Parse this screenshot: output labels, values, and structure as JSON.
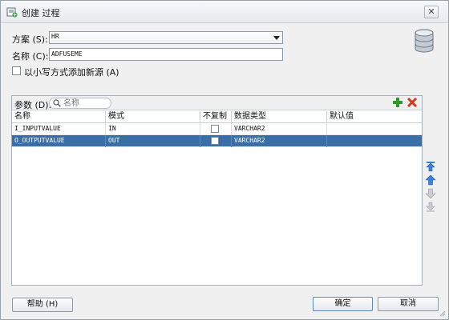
{
  "window": {
    "title": "创建 过程"
  },
  "form": {
    "schema_label": "方案 (S):",
    "schema_value": "HR",
    "name_label": "名称 (C):",
    "name_value": "ADFUSEME",
    "lowercase_label": "以小写方式添加新源 (A)"
  },
  "params": {
    "label": "参数 (D):",
    "search_placeholder": "名称",
    "columns": [
      "名称",
      "模式",
      "不复制",
      "数据类型",
      "默认值"
    ],
    "rows": [
      {
        "name": "I_INPUTVALUE",
        "mode": "IN",
        "nocopy": false,
        "type": "VARCHAR2",
        "default": "",
        "selected": false
      },
      {
        "name": "O_OUTPUTVALUE",
        "mode": "OUT",
        "nocopy": false,
        "type": "VARCHAR2",
        "default": "",
        "selected": true
      }
    ]
  },
  "buttons": {
    "help": "帮助 (H)",
    "ok": "确定",
    "cancel": "取消"
  },
  "colors": {
    "selection": "#3a6ea6",
    "add_green": "#2e9b2e",
    "delete_red": "#d23a1f",
    "arrow_blue": "#3b82d6"
  }
}
